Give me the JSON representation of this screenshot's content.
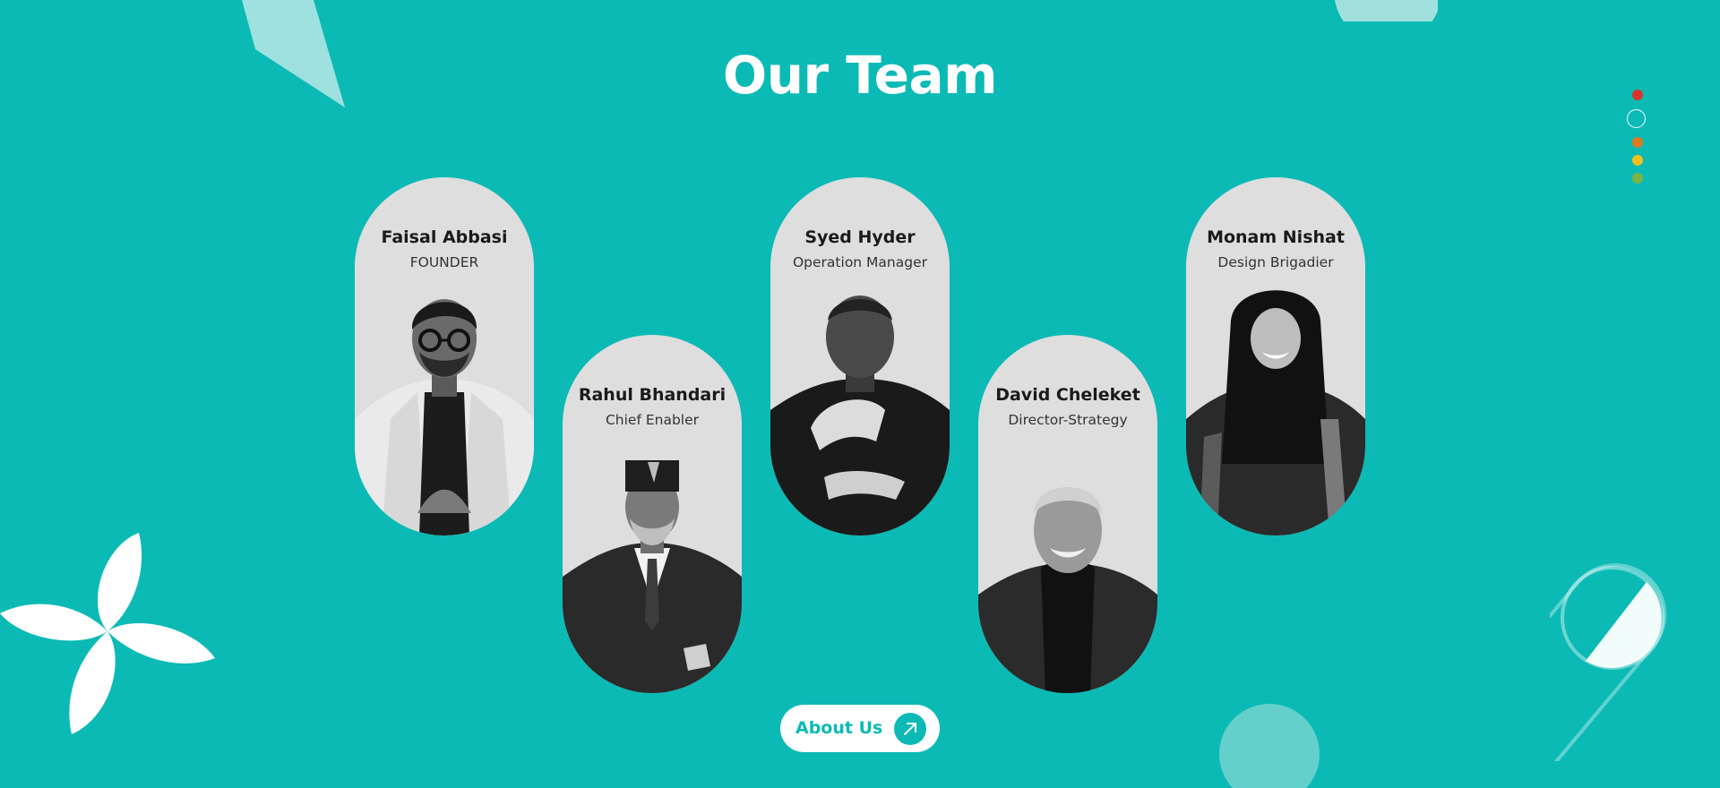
{
  "section": {
    "title": "Our Team"
  },
  "team": [
    {
      "name": "Faisal Abbasi",
      "role": "FOUNDER"
    },
    {
      "name": "Rahul Bhandari",
      "role": "Chief Enabler"
    },
    {
      "name": "Syed Hyder",
      "role": "Operation Manager"
    },
    {
      "name": "David Cheleket",
      "role": "Director-Strategy"
    },
    {
      "name": "Monam Nishat",
      "role": "Design Brigadier"
    }
  ],
  "about_button": {
    "label": "About Us",
    "icon": "arrow-up-right-icon"
  },
  "slide_dots": {
    "colors": [
      "#d9342b",
      "#ffffff",
      "#e07a1f",
      "#f2c11d",
      "#7cb342"
    ],
    "active_index": 1
  },
  "colors": {
    "background": "#0bbab5",
    "card": "#dedede",
    "accent": "#0bbab5"
  }
}
